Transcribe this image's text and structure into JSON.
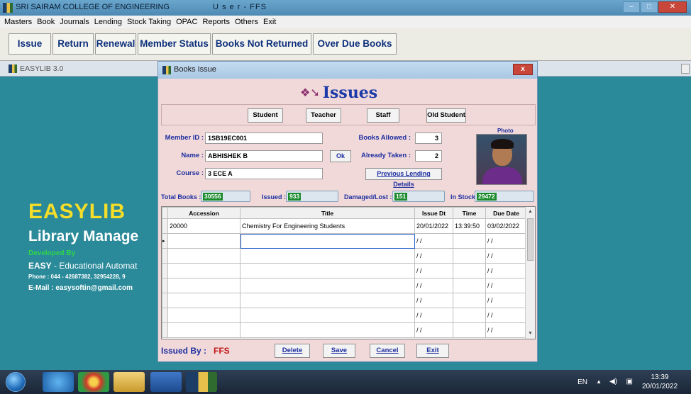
{
  "window": {
    "title": "SRI SAIRAM COLLEGE OF ENGINEERING",
    "user": "U s e r - FFS"
  },
  "menu": [
    "Masters",
    "Book",
    "Journals",
    "Lending",
    "Stock Taking",
    "OPAC",
    "Reports",
    "Others",
    "Exit"
  ],
  "toolbar": {
    "issue": "Issue",
    "return": "Return",
    "renewal": "Renewal",
    "member_status": "Member Status",
    "books_not_returned": "Books Not Returned",
    "over_due_books": "Over Due Books"
  },
  "mdi": {
    "title": "EASYLIB 3.0"
  },
  "splash": {
    "easylib": "EASYLIB",
    "library_manage": "Library Manage",
    "developed_by": "Developed By",
    "easy_prefix": "EASY",
    "easy_rest": " - Educational Automat",
    "phone": "Phone : 044 - 42687382, 32954228, 9",
    "email": "E-Mail : easysoftin@gmail.com"
  },
  "dialog": {
    "title": "Books Issue",
    "close": "x",
    "heading": "Issues",
    "roles": {
      "student": "Student",
      "teacher": "Teacher",
      "staff": "Staff",
      "old_student": "Old Student"
    },
    "member": {
      "member_id_label": "Member ID :",
      "member_id": "1SB19EC001",
      "name_label": "Name :",
      "name": "ABHISHEK B",
      "course_label": "Course :",
      "course": "3 ECE A",
      "ok": "Ok",
      "books_allowed_label": "Books Allowed :",
      "books_allowed": "3",
      "already_taken_label": "Already Taken :",
      "already_taken": "2",
      "previous_lending": "Previous Lending Details",
      "photo_label": "Photo"
    },
    "stats": {
      "total_books_label": "Total Books :",
      "total_books": "30556",
      "issued_label": "Issued :",
      "issued": "933",
      "damaged_label": "Damaged/Lost :",
      "damaged": "151",
      "in_stock_label": "In Stock :",
      "in_stock": "29472"
    },
    "grid": {
      "columns": [
        "Accession",
        "Title",
        "Issue Dt",
        "Time",
        "Due Date"
      ],
      "rows": [
        [
          "20000",
          "Chemistry For Engineering Students",
          "20/01/2022",
          "13:39:50",
          "03/02/2022"
        ],
        [
          "",
          "",
          "/ /",
          "",
          "/ /"
        ],
        [
          "",
          "",
          "/ /",
          "",
          "/ /"
        ],
        [
          "",
          "",
          "/ /",
          "",
          "/ /"
        ],
        [
          "",
          "",
          "/ /",
          "",
          "/ /"
        ],
        [
          "",
          "",
          "/ /",
          "",
          "/ /"
        ],
        [
          "",
          "",
          "/ /",
          "",
          "/ /"
        ],
        [
          "",
          "",
          "/ /",
          "",
          "/ /"
        ]
      ]
    },
    "issued_by_label": "Issued By :",
    "issued_by": "FFS",
    "buttons": {
      "delete": "Delete",
      "save": "Save",
      "cancel": "Cancel",
      "exit": "Exit"
    }
  },
  "taskbar": {
    "lang": "EN",
    "time": "13:39",
    "date": "20/01/2022"
  }
}
